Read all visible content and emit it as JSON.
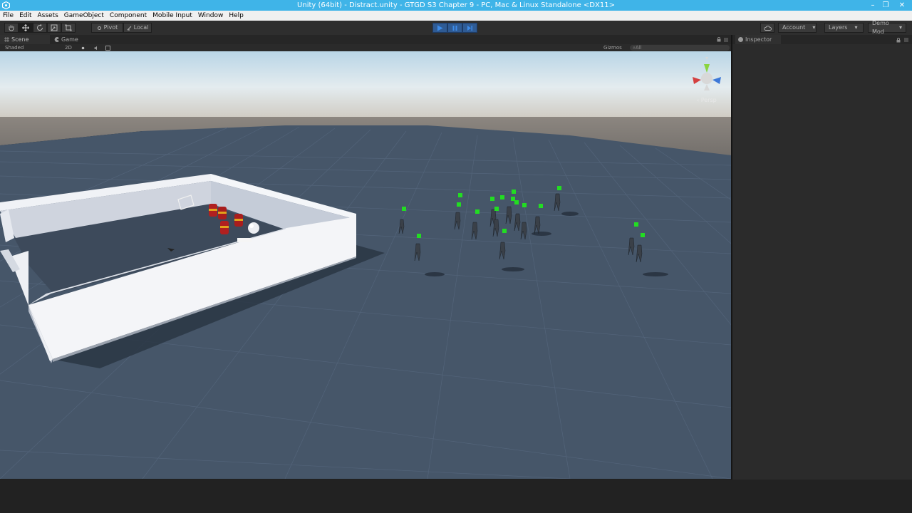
{
  "window": {
    "title": "Unity (64bit) - Distract.unity - GTGD S3 Chapter 9 - PC, Mac & Linux Standalone <DX11>",
    "minimize_glyph": "–",
    "restore_glyph": "❐",
    "close_glyph": "✕"
  },
  "menu": {
    "items": [
      "File",
      "Edit",
      "Assets",
      "GameObject",
      "Component",
      "Mobile Input",
      "Window",
      "Help"
    ]
  },
  "toolbar": {
    "pivot_label": "Pivot",
    "local_label": "Local",
    "account_label": "Account",
    "layers_label": "Layers",
    "layout_label": "Demo Mod",
    "dropdown_arrow": "▾"
  },
  "scene_tabs": {
    "scene_label": "Scene",
    "game_label": "Game",
    "shading_mode": "Shaded",
    "mode_2d": "2D",
    "gizmos_label": "Gizmos",
    "search_placeholder": "⌕All"
  },
  "inspector": {
    "tab_label": "Inspector"
  },
  "gizmo": {
    "projection_label": "‹ Persp"
  },
  "colors": {
    "title_bar": "#3fb4e8",
    "play_button": "#2f5b94",
    "ground": "#465669",
    "wall": "#e4e8f0",
    "barrel": "#b02020",
    "enemy_marker": "#22dd22"
  }
}
